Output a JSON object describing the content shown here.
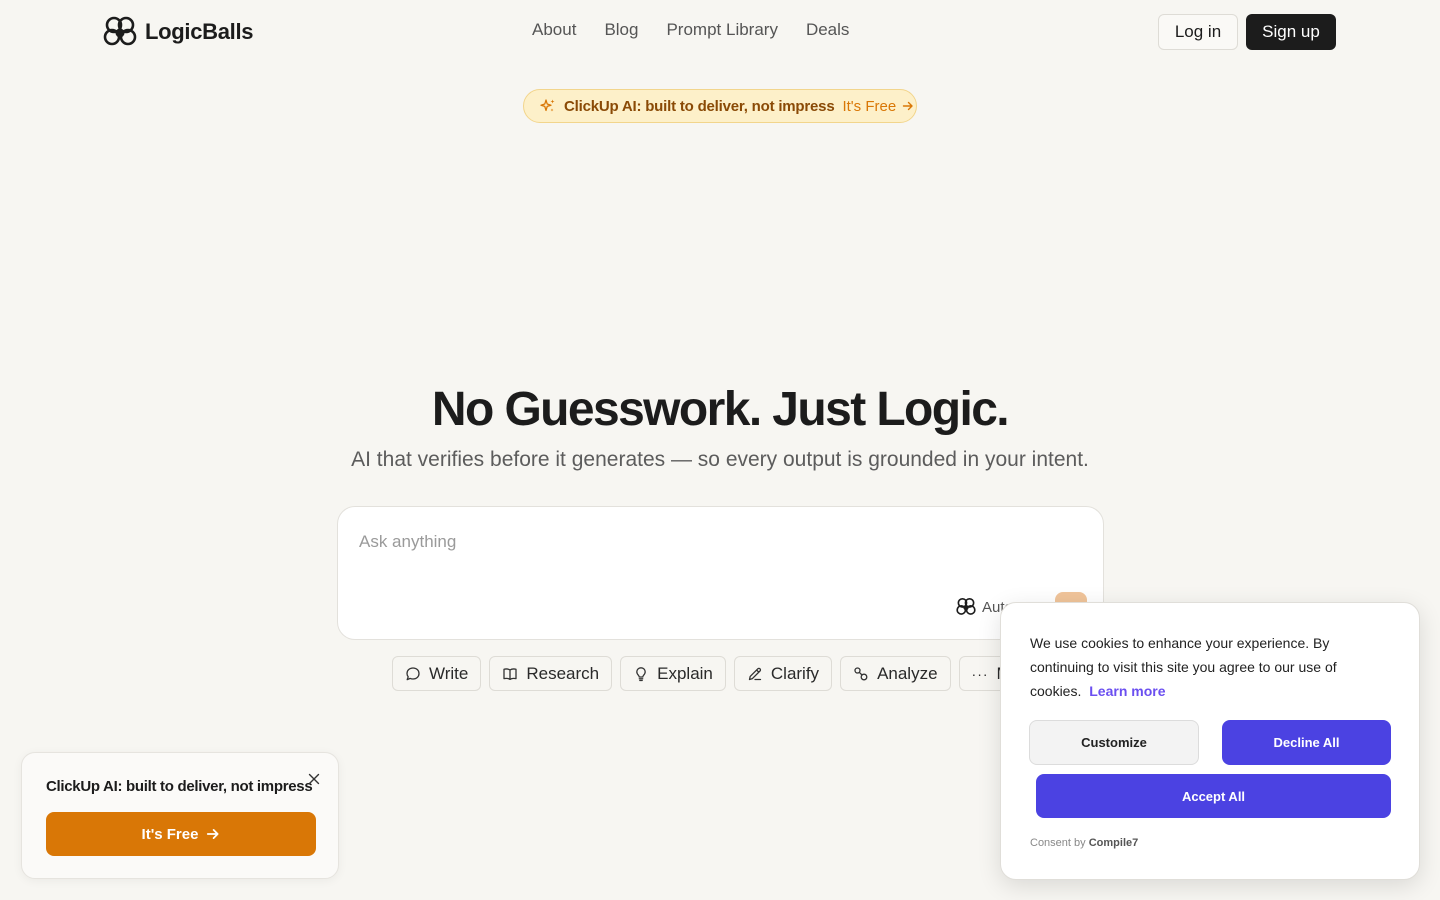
{
  "header": {
    "brand": "LogicBalls",
    "nav": [
      "About",
      "Blog",
      "Prompt Library",
      "Deals"
    ],
    "login_label": "Log in",
    "signup_label": "Sign up"
  },
  "promo": {
    "text": "ClickUp AI: built to deliver, not impress",
    "cta": "It's Free"
  },
  "hero": {
    "title": "No Guesswork. Just Logic.",
    "subtitle": "AI that verifies before it generates — so every output is grounded in your intent.",
    "placeholder": "Ask anything",
    "mode_label": "Auto"
  },
  "chips": [
    {
      "label": "Write",
      "icon": "chat-bubble-icon"
    },
    {
      "label": "Research",
      "icon": "book-icon"
    },
    {
      "label": "Explain",
      "icon": "lightbulb-icon"
    },
    {
      "label": "Clarify",
      "icon": "pencil-icon"
    },
    {
      "label": "Analyze",
      "icon": "nodes-icon"
    },
    {
      "label": "M",
      "icon": "more-icon"
    }
  ],
  "left_card": {
    "title": "ClickUp AI: built to deliver, not impress",
    "button_label": "It's Free"
  },
  "cookie": {
    "text": "We use cookies to enhance your experience. By continuing to visit this site you agree to our use of cookies.",
    "learn_more": "Learn more",
    "customize": "Customize",
    "decline": "Decline All",
    "accept": "Accept All",
    "consent_prefix": "Consent by",
    "consent_brand": "Compile7"
  },
  "colors": {
    "background": "#f7f6f2",
    "accent_orange": "#d97706",
    "accent_indigo": "#4b42e2"
  }
}
